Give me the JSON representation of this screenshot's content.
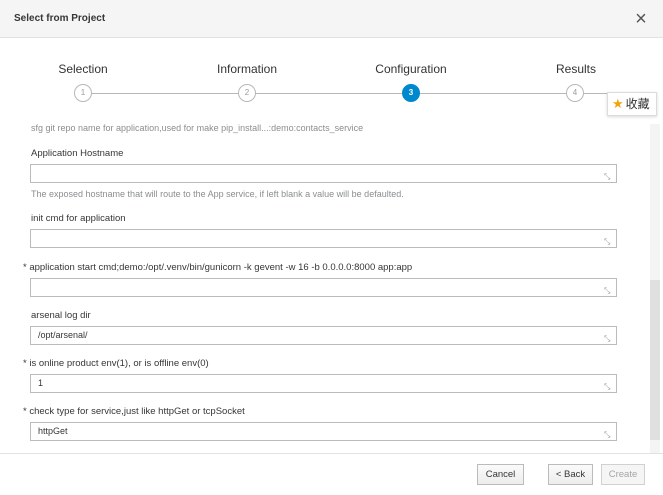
{
  "header": {
    "title": "Select from Project",
    "close_glyph": "×"
  },
  "wizard": {
    "active_step": 3,
    "steps": [
      {
        "label": "Selection",
        "number": "1"
      },
      {
        "label": "Information",
        "number": "2"
      },
      {
        "label": "Configuration",
        "number": "3"
      },
      {
        "label": "Results",
        "number": "4"
      }
    ]
  },
  "favorite": {
    "label": "收藏",
    "icon": "star-icon"
  },
  "form": {
    "top_help": "sfg git repo name for application,used for make pip_install...:demo:contacts_service",
    "fields": [
      {
        "label": "Application Hostname",
        "required": false,
        "value": "",
        "help": "The exposed hostname that will route to the App service, if left blank a value will be defaulted."
      },
      {
        "label": "init cmd for application",
        "required": false,
        "value": "",
        "help": ""
      },
      {
        "label": "* application start cmd;demo:/opt/.venv/bin/gunicorn -k gevent -w 16 -b 0.0.0.0:8000 app:app",
        "required": true,
        "value": "",
        "help": ""
      },
      {
        "label": "arsenal log dir",
        "required": false,
        "value": "/opt/arsenal/",
        "help": ""
      },
      {
        "label": "* is online product env(1), or is offline env(0)",
        "required": true,
        "value": "1",
        "help": ""
      },
      {
        "label": "* check type for service,just like httpGet or tcpSocket",
        "required": true,
        "value": "httpGet",
        "help": ""
      }
    ]
  },
  "footer": {
    "cancel_label": "Cancel",
    "back_label": "< Back",
    "create_label": "Create"
  },
  "colors": {
    "accent": "#0088ce",
    "star": "#f0a30a"
  }
}
